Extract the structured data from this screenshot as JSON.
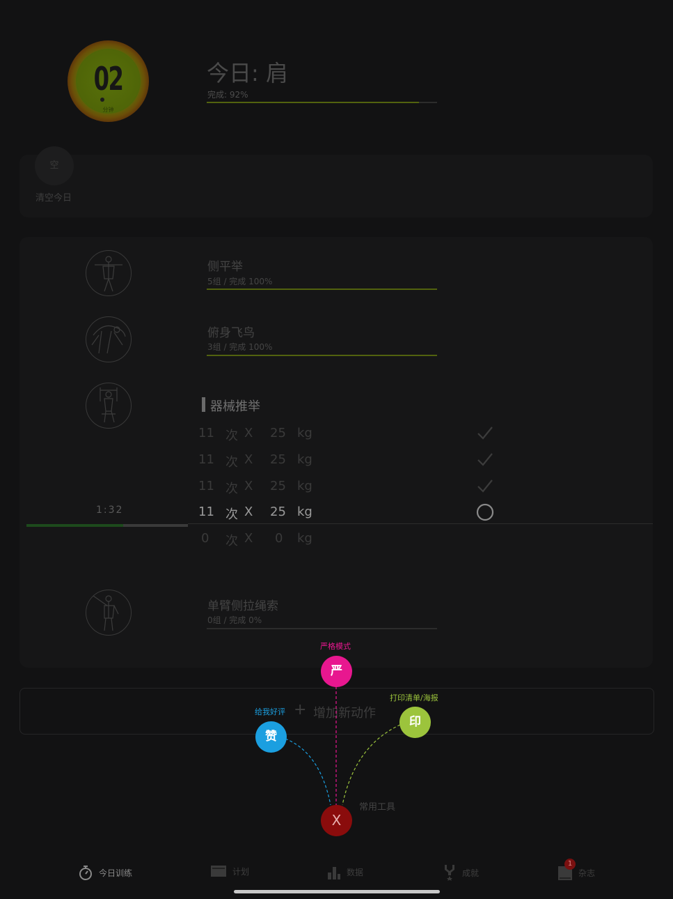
{
  "header": {
    "timer_value": "02",
    "timer_unit": "分钟",
    "title": "今日: 肩",
    "progress_text": "完成: 92%",
    "progress": 0.92
  },
  "clear_today": {
    "icon_text": "空",
    "label": "清空今日"
  },
  "exercises": [
    {
      "name": "侧平举",
      "sub": "5组 / 完成 100%",
      "progress": 1.0
    },
    {
      "name": "俯身飞鸟",
      "sub": "3组 / 完成 100%",
      "progress": 1.0
    },
    {
      "name": "单臂侧拉绳索",
      "sub": "0组 / 完成 0%",
      "progress": 0
    }
  ],
  "active_exercise": {
    "name": "器械推举",
    "rest_timer": "1:32",
    "rest_progress": 0.6,
    "sets": [
      {
        "reps": "11",
        "reps_unit": "次",
        "times": "X",
        "weight": "25",
        "weight_unit": "kg",
        "done": true
      },
      {
        "reps": "11",
        "reps_unit": "次",
        "times": "X",
        "weight": "25",
        "weight_unit": "kg",
        "done": true
      },
      {
        "reps": "11",
        "reps_unit": "次",
        "times": "X",
        "weight": "25",
        "weight_unit": "kg",
        "done": true
      },
      {
        "reps": "11",
        "reps_unit": "次",
        "times": "X",
        "weight": "25",
        "weight_unit": "kg",
        "done": false
      },
      {
        "reps": "0",
        "reps_unit": "次",
        "times": "X",
        "weight": "0",
        "weight_unit": "kg",
        "done": false
      }
    ]
  },
  "add_action": {
    "label": "增加新动作"
  },
  "tools_menu": {
    "strict_mode_label": "严格模式",
    "strict_mode_icon": "严",
    "rate_label": "给我好评",
    "rate_icon": "赞",
    "print_label": "打印清单/海报",
    "print_icon": "印",
    "close_icon": "X",
    "caption": "常用工具",
    "colors": {
      "strict": "#e8178f",
      "rate": "#1b9fe0",
      "print": "#9cc43c",
      "close": "#8a0c0c"
    }
  },
  "tabbar": {
    "items": [
      {
        "label": "今日训练",
        "icon": "stopwatch-icon",
        "active": true
      },
      {
        "label": "计划",
        "icon": "calendar-icon",
        "active": false
      },
      {
        "label": "数据",
        "icon": "bar-chart-icon",
        "active": false
      },
      {
        "label": "成就",
        "icon": "trophy-icon",
        "active": false
      },
      {
        "label": "杂志",
        "icon": "book-icon",
        "active": false,
        "badge": "1"
      }
    ]
  }
}
